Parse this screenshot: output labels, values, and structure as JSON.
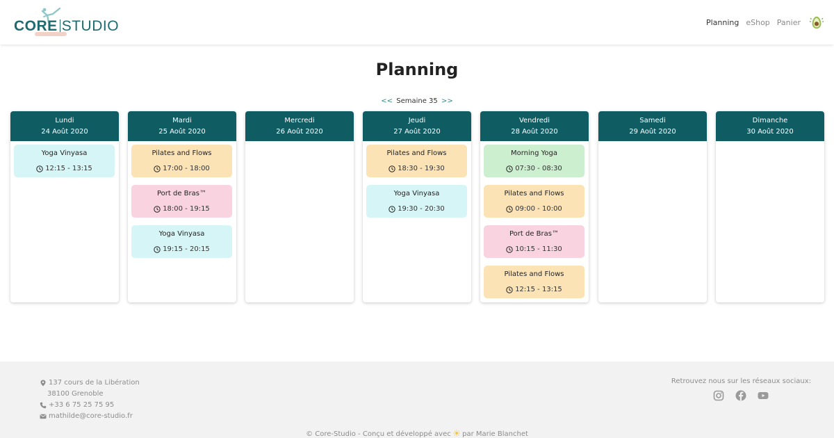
{
  "header": {
    "logo_text_core": "CORE",
    "logo_text_studio": "STUDIO",
    "nav": [
      {
        "label": "Planning",
        "active": true
      },
      {
        "label": "eShop",
        "active": false
      },
      {
        "label": "Panier",
        "active": false
      }
    ],
    "cart_icon": "avocado-icon"
  },
  "page": {
    "title": "Planning",
    "week_prev": "<<",
    "week_label": "Semaine 35",
    "week_next": ">>"
  },
  "colors": {
    "header_teal": "#0f5d63",
    "yellow": "#fbe3b6",
    "pink": "#f9d3df",
    "cyan": "#d6f5f6",
    "green": "#ccefcf"
  },
  "days": [
    {
      "name": "Lundi",
      "date": "24 Août 2020",
      "classes": [
        {
          "name": "Yoga Vinyasa",
          "time": "12:15 - 13:15",
          "color": "cyan"
        }
      ]
    },
    {
      "name": "Mardi",
      "date": "25 Août 2020",
      "classes": [
        {
          "name": "Pilates and Flows",
          "time": "17:00 - 18:00",
          "color": "yellow"
        },
        {
          "name": "Port de Bras™",
          "time": "18:00 - 19:15",
          "color": "pink"
        },
        {
          "name": "Yoga Vinyasa",
          "time": "19:15 - 20:15",
          "color": "cyan"
        }
      ]
    },
    {
      "name": "Mercredi",
      "date": "26 Août 2020",
      "classes": []
    },
    {
      "name": "Jeudi",
      "date": "27 Août 2020",
      "classes": [
        {
          "name": "Pilates and Flows",
          "time": "18:30 - 19:30",
          "color": "yellow"
        },
        {
          "name": "Yoga Vinyasa",
          "time": "19:30 - 20:30",
          "color": "cyan"
        }
      ]
    },
    {
      "name": "Vendredi",
      "date": "28 Août 2020",
      "classes": [
        {
          "name": "Morning Yoga",
          "time": "07:30 - 08:30",
          "color": "green"
        },
        {
          "name": "Pilates and Flows",
          "time": "09:00 - 10:00",
          "color": "yellow"
        },
        {
          "name": "Port de Bras™",
          "time": "10:15 - 11:30",
          "color": "pink"
        },
        {
          "name": "Pilates and Flows",
          "time": "12:15 - 13:15",
          "color": "yellow"
        }
      ]
    },
    {
      "name": "Samedi",
      "date": "29 Août 2020",
      "classes": []
    },
    {
      "name": "Dimanche",
      "date": "30 Août 2020",
      "classes": []
    }
  ],
  "footer": {
    "address_line1": "137 cours de la Libération",
    "address_line2": "38100 Grenoble",
    "phone": "+33 6 75 25 75 95",
    "email": "mathilde@core-studio.fr",
    "social_label": "Retrouvez nous sur les réseaux sociaux:",
    "social_icons": [
      "instagram-icon",
      "facebook-icon",
      "youtube-icon"
    ],
    "copyright_prefix": "© Core-Studio - Conçu et développé avec",
    "copyright_by": "par",
    "copyright_author": "Marie Blanchet"
  }
}
